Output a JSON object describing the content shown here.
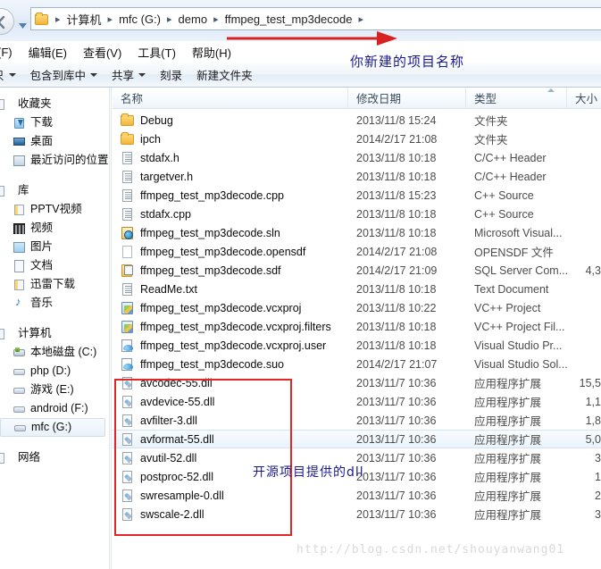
{
  "addressbar": {
    "folder_icon": "folder-icon",
    "back_icon": "back-arrow-icon",
    "dropdown_icon": "history-dropdown-icon",
    "crumbs": [
      "计算机",
      "mfc (G:)",
      "demo",
      "ffmpeg_test_mp3decode"
    ],
    "separator": "▸"
  },
  "menubar": {
    "items": [
      "(F)",
      "编辑(E)",
      "查看(V)",
      "工具(T)",
      "帮助(H)"
    ]
  },
  "toolbar": {
    "items": [
      {
        "label": "只",
        "caret": true
      },
      {
        "label": "包含到库中",
        "caret": true
      },
      {
        "label": "共享",
        "caret": true
      },
      {
        "label": "刻录",
        "caret": false
      },
      {
        "label": "新建文件夹",
        "caret": false
      }
    ]
  },
  "sidebar": {
    "sections": [
      {
        "header": "收藏夹",
        "header_icon": "favorites-icon",
        "items": [
          {
            "label": "下载",
            "icon": "downloads-icon",
            "cls": "si-dl"
          },
          {
            "label": "桌面",
            "icon": "desktop-icon",
            "cls": "si-desktop"
          },
          {
            "label": "最近访问的位置",
            "icon": "recent-places-icon",
            "cls": "si-recent"
          }
        ]
      },
      {
        "header": "库",
        "header_icon": "libraries-icon",
        "items": [
          {
            "label": "PPTV视频",
            "icon": "pptv-video-library-icon",
            "cls": "si-lib"
          },
          {
            "label": "视频",
            "icon": "videos-library-icon",
            "cls": "si-vid"
          },
          {
            "label": "图片",
            "icon": "pictures-library-icon",
            "cls": "si-pic"
          },
          {
            "label": "文档",
            "icon": "documents-library-icon",
            "cls": "si-doc2"
          },
          {
            "label": "迅雷下载",
            "icon": "thunder-download-library-icon",
            "cls": "si-lib"
          },
          {
            "label": "音乐",
            "icon": "music-library-icon",
            "cls": "si-music"
          }
        ]
      },
      {
        "header": "计算机",
        "header_icon": "computer-icon",
        "items": [
          {
            "label": "本地磁盘 (C:)",
            "icon": "system-drive-icon",
            "cls": "si-drivec",
            "selected": false
          },
          {
            "label": "php (D:)",
            "icon": "drive-icon",
            "cls": "si-drive",
            "selected": false
          },
          {
            "label": "游戏 (E:)",
            "icon": "drive-icon",
            "cls": "si-drive",
            "selected": false
          },
          {
            "label": "android (F:)",
            "icon": "drive-icon",
            "cls": "si-drive",
            "selected": false
          },
          {
            "label": "mfc (G:)",
            "icon": "drive-icon",
            "cls": "si-drive",
            "selected": true
          }
        ]
      },
      {
        "header": "网络",
        "header_icon": "network-icon",
        "items": []
      }
    ]
  },
  "filelist": {
    "columns": [
      {
        "label": "名称",
        "key": "name",
        "cls": "c-name"
      },
      {
        "label": "修改日期",
        "key": "date",
        "cls": "c-date"
      },
      {
        "label": "类型",
        "key": "type",
        "cls": "c-type",
        "sorted": true
      },
      {
        "label": "大小",
        "key": "size",
        "cls": "c-size"
      }
    ],
    "rows": [
      {
        "name": "Debug",
        "date": "2013/11/8 15:24",
        "type": "文件夹",
        "size": "",
        "icon": "folder-icon",
        "cls": "ic-folder",
        "selected": false
      },
      {
        "name": "ipch",
        "date": "2014/2/17 21:08",
        "type": "文件夹",
        "size": "",
        "icon": "folder-icon",
        "cls": "ic-folder",
        "selected": false
      },
      {
        "name": "stdafx.h",
        "date": "2013/11/8 10:18",
        "type": "C/C++ Header",
        "size": "",
        "icon": "header-file-icon",
        "cls": "ic-doc lined",
        "selected": false
      },
      {
        "name": "targetver.h",
        "date": "2013/11/8 10:18",
        "type": "C/C++ Header",
        "size": "",
        "icon": "header-file-icon",
        "cls": "ic-doc lined",
        "selected": false
      },
      {
        "name": "ffmpeg_test_mp3decode.cpp",
        "date": "2013/11/8 15:23",
        "type": "C++ Source",
        "size": "",
        "icon": "cpp-source-icon",
        "cls": "ic-doc lined",
        "selected": false
      },
      {
        "name": "stdafx.cpp",
        "date": "2013/11/8 10:18",
        "type": "C++ Source",
        "size": "",
        "icon": "cpp-source-icon",
        "cls": "ic-doc lined",
        "selected": false
      },
      {
        "name": "ffmpeg_test_mp3decode.sln",
        "date": "2013/11/8 10:18",
        "type": "Microsoft Visual...",
        "size": "",
        "icon": "visual-studio-solution-icon",
        "cls": "ic-vs",
        "selected": false
      },
      {
        "name": "ffmpeg_test_mp3decode.opensdf",
        "date": "2014/2/17 21:08",
        "type": "OPENSDF 文件",
        "size": "",
        "icon": "blank-file-icon",
        "cls": "ic-blank",
        "selected": false
      },
      {
        "name": "ffmpeg_test_mp3decode.sdf",
        "date": "2014/2/17 21:09",
        "type": "SQL Server Com...",
        "size": "4,3",
        "icon": "sql-server-compact-icon",
        "cls": "ic-sdf",
        "selected": false
      },
      {
        "name": "ReadMe.txt",
        "date": "2013/11/8 10:18",
        "type": "Text Document",
        "size": "",
        "icon": "text-document-icon",
        "cls": "ic-doc lined",
        "selected": false
      },
      {
        "name": "ffmpeg_test_mp3decode.vcxproj",
        "date": "2013/11/8 10:22",
        "type": "VC++ Project",
        "size": "",
        "icon": "vcxproj-icon",
        "cls": "ic-vsproj",
        "selected": false
      },
      {
        "name": "ffmpeg_test_mp3decode.vcxproj.filters",
        "date": "2013/11/8 10:18",
        "type": "VC++ Project Fil...",
        "size": "",
        "icon": "vcxproj-filters-icon",
        "cls": "ic-vsproj",
        "selected": false
      },
      {
        "name": "ffmpeg_test_mp3decode.vcxproj.user",
        "date": "2013/11/8 10:18",
        "type": "Visual Studio Pr...",
        "size": "",
        "icon": "vcxproj-user-icon",
        "cls": "ic-vsuser",
        "selected": false
      },
      {
        "name": "ffmpeg_test_mp3decode.suo",
        "date": "2014/2/17 21:07",
        "type": "Visual Studio Sol...",
        "size": "",
        "icon": "suo-file-icon",
        "cls": "ic-vsuser",
        "selected": false
      },
      {
        "name": "avcodec-55.dll",
        "date": "2013/11/7 10:36",
        "type": "应用程序扩展",
        "size": "15,5",
        "icon": "dll-icon",
        "cls": "ic-dll",
        "selected": false
      },
      {
        "name": "avdevice-55.dll",
        "date": "2013/11/7 10:36",
        "type": "应用程序扩展",
        "size": "1,1",
        "icon": "dll-icon",
        "cls": "ic-dll",
        "selected": false
      },
      {
        "name": "avfilter-3.dll",
        "date": "2013/11/7 10:36",
        "type": "应用程序扩展",
        "size": "1,8",
        "icon": "dll-icon",
        "cls": "ic-dll",
        "selected": false
      },
      {
        "name": "avformat-55.dll",
        "date": "2013/11/7 10:36",
        "type": "应用程序扩展",
        "size": "5,0",
        "icon": "dll-icon",
        "cls": "ic-dll",
        "selected": true
      },
      {
        "name": "avutil-52.dll",
        "date": "2013/11/7 10:36",
        "type": "应用程序扩展",
        "size": "3",
        "icon": "dll-icon",
        "cls": "ic-dll",
        "selected": false
      },
      {
        "name": "postproc-52.dll",
        "date": "2013/11/7 10:36",
        "type": "应用程序扩展",
        "size": "1",
        "icon": "dll-icon",
        "cls": "ic-dll",
        "selected": false
      },
      {
        "name": "swresample-0.dll",
        "date": "2013/11/7 10:36",
        "type": "应用程序扩展",
        "size": "2",
        "icon": "dll-icon",
        "cls": "ic-dll",
        "selected": false
      },
      {
        "name": "swscale-2.dll",
        "date": "2013/11/7 10:36",
        "type": "应用程序扩展",
        "size": "3",
        "icon": "dll-icon",
        "cls": "ic-dll",
        "selected": false
      }
    ]
  },
  "annotations": {
    "project_name_note": "你新建的项目名称",
    "dll_note": "开源项目提供的dll",
    "arrow_color": "#d82121",
    "box_color": "#e32727",
    "note_color": "#1a1a8c"
  },
  "watermark": "http://blog.csdn.net/shouyanwang01"
}
